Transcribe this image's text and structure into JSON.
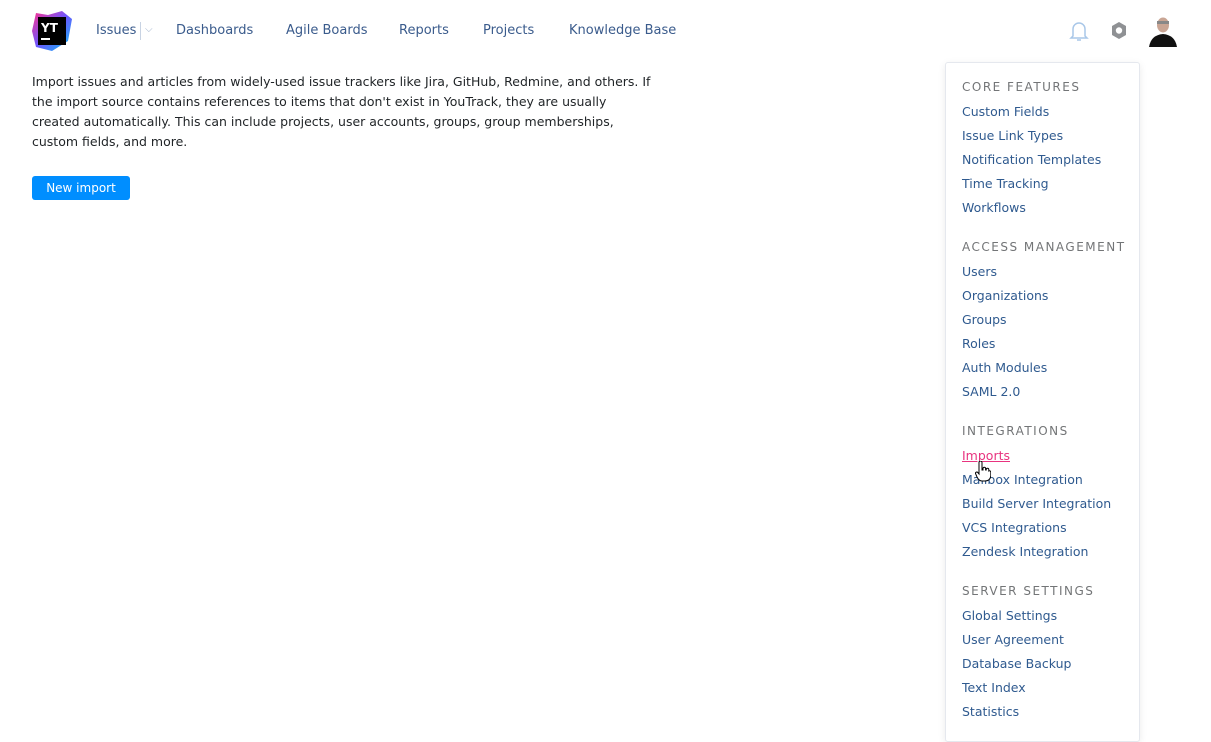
{
  "header": {
    "logo_text": "YT",
    "nav": [
      "Issues",
      "Dashboards",
      "Agile Boards",
      "Reports",
      "Projects",
      "Knowledge Base"
    ]
  },
  "main": {
    "intro": "Import issues and articles from widely-used issue trackers like Jira, GitHub, Redmine, and others. If the import source contains references to items that don't exist in YouTrack, they are usually created automatically. This can include projects, user accounts, groups, group memberships, custom fields, and more.",
    "new_import": "New import"
  },
  "menu": {
    "sections": [
      {
        "title": "CORE FEATURES",
        "items": [
          "Custom Fields",
          "Issue Link Types",
          "Notification Templates",
          "Time Tracking",
          "Workflows"
        ]
      },
      {
        "title": "ACCESS MANAGEMENT",
        "items": [
          "Users",
          "Organizations",
          "Groups",
          "Roles",
          "Auth Modules",
          "SAML 2.0"
        ]
      },
      {
        "title": "INTEGRATIONS",
        "items": [
          "Imports",
          "Mailbox Integration",
          "Build Server Integration",
          "VCS Integrations",
          "Zendesk Integration"
        ]
      },
      {
        "title": "SERVER SETTINGS",
        "items": [
          "Global Settings",
          "User Agreement",
          "Database Backup",
          "Text Index",
          "Statistics"
        ]
      }
    ],
    "active": "Imports",
    "active_color": "#e8337f"
  }
}
